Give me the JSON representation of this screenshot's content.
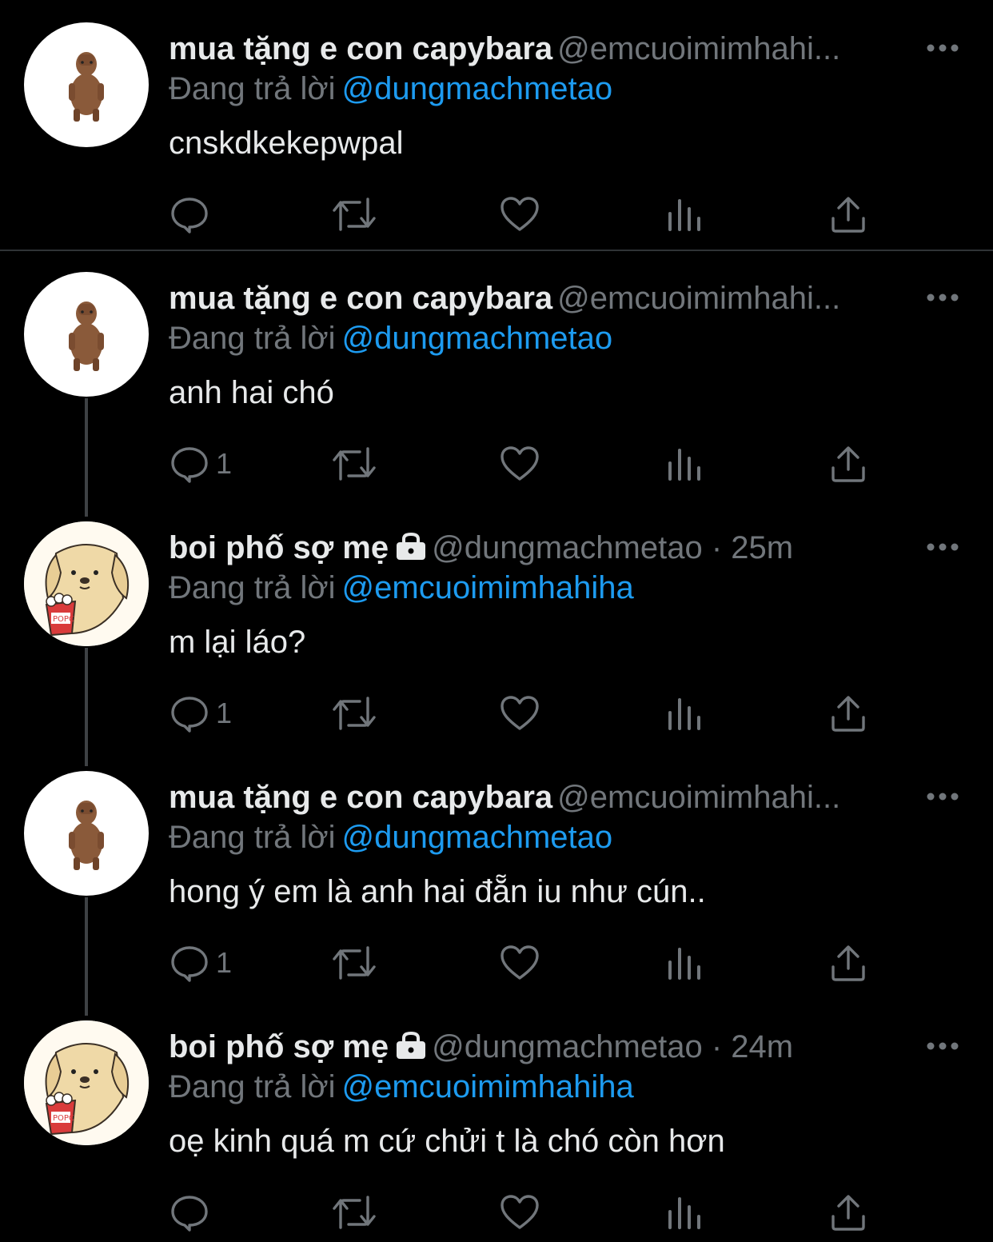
{
  "tweets": [
    {
      "display_name": "mua tặng e con capybara",
      "handle": "@emcuoimimhahi...",
      "locked": false,
      "reply_prefix": "Đang trả lời",
      "reply_to": "@dungmachmetao",
      "text": "cnskdkekepwpal",
      "reply_count": "",
      "avatar": "capybara-avatar"
    },
    {
      "display_name": "mua tặng e con capybara",
      "handle": "@emcuoimimhahi...",
      "locked": false,
      "reply_prefix": "Đang trả lời",
      "reply_to": "@dungmachmetao",
      "text": "anh hai chó",
      "reply_count": "1",
      "avatar": "capybara-avatar"
    },
    {
      "display_name": "boi phố sợ mẹ",
      "handle": "@dungmachmetao · 25m",
      "locked": true,
      "reply_prefix": "Đang trả lời",
      "reply_to": "@emcuoimimhahiha",
      "text": "m lại láo?",
      "reply_count": "1",
      "avatar": "dog-popcorn-avatar"
    },
    {
      "display_name": "mua tặng e con capybara",
      "handle": "@emcuoimimhahi...",
      "locked": false,
      "reply_prefix": "Đang trả lời",
      "reply_to": "@dungmachmetao",
      "text": "hong ý em là anh hai đẵn iu như cún..",
      "reply_count": "1",
      "avatar": "capybara-avatar"
    },
    {
      "display_name": "boi phố sợ mẹ",
      "handle": "@dungmachmetao · 24m",
      "locked": true,
      "reply_prefix": "Đang trả lời",
      "reply_to": "@emcuoimimhahiha",
      "text": "oẹ kinh quá m cứ chửi t là chó còn hơn",
      "reply_count": "",
      "avatar": "dog-popcorn-avatar"
    }
  ],
  "popcorn_label": "POPC",
  "icons": [
    "reply-icon",
    "retweet-icon",
    "like-icon",
    "views-icon",
    "share-icon",
    "more-icon",
    "lock-icon"
  ],
  "colors": {
    "background": "#000000",
    "primary_text": "#e7e9ea",
    "secondary_text": "#71767b",
    "link": "#1d9bf0",
    "divider": "#2f3336"
  }
}
